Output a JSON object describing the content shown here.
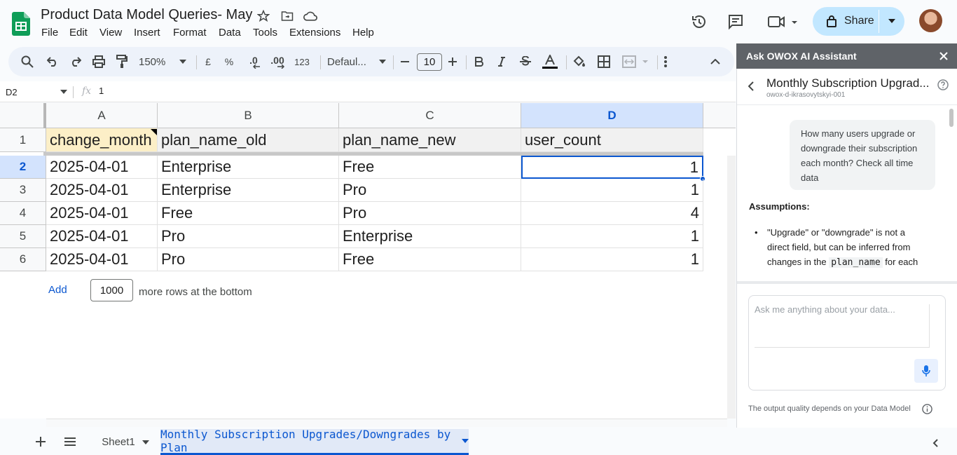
{
  "app": {
    "title": "Product Data Model Queries- May",
    "menu": [
      "File",
      "Edit",
      "View",
      "Insert",
      "Format",
      "Data",
      "Tools",
      "Extensions",
      "Help"
    ],
    "share_label": "Share"
  },
  "toolbar": {
    "zoom": "150%",
    "currency": "£",
    "percent": "%",
    "dec_less": ".0",
    "dec_more": ".00",
    "number_format": "123",
    "font": "Defaul...",
    "font_size": "10"
  },
  "formula_bar": {
    "cell_ref": "D2",
    "fx": "fx",
    "value": "1"
  },
  "sheet": {
    "columns": [
      "A",
      "B",
      "C",
      "D"
    ],
    "rows": [
      "1",
      "2",
      "3",
      "4",
      "5",
      "6"
    ],
    "header": [
      "change_month",
      "plan_name_old",
      "plan_name_new",
      "user_count"
    ],
    "data": [
      [
        "2025-04-01",
        "Enterprise",
        "Free",
        "1"
      ],
      [
        "2025-04-01",
        "Enterprise",
        "Pro",
        "1"
      ],
      [
        "2025-04-01",
        "Free",
        "Pro",
        "4"
      ],
      [
        "2025-04-01",
        "Pro",
        "Enterprise",
        "1"
      ],
      [
        "2025-04-01",
        "Pro",
        "Free",
        "1"
      ]
    ],
    "add_label": "Add",
    "add_rows": "1000",
    "add_suffix": "more rows at the bottom"
  },
  "tabs": {
    "items": [
      "Sheet1",
      "Monthly Subscription Upgrades/Downgrades by Plan"
    ],
    "active_index": 1
  },
  "assistant": {
    "panel_title": "Ask OWOX AI Assistant",
    "chat_title": "Monthly Subscription Upgrad...",
    "chat_subtitle": "owox-d-ikrasovytskyi-001",
    "user_message": "How many users upgrade or downgrade their subscription each month? Check all time data",
    "assumptions_label": "Assumptions:",
    "bullet_part1": "\"Upgrade\" or \"downgrade\" is not a direct field, but can be inferred from changes in the",
    "bullet_code": "plan_name",
    "bullet_part2": "for each",
    "input_placeholder": "Ask me anything about your data...",
    "footer": "The output quality depends on your Data Model"
  },
  "colors": {
    "accent": "#0b57d0",
    "share_bg": "#c2e7ff",
    "selected_header": "#d3e3fd"
  }
}
